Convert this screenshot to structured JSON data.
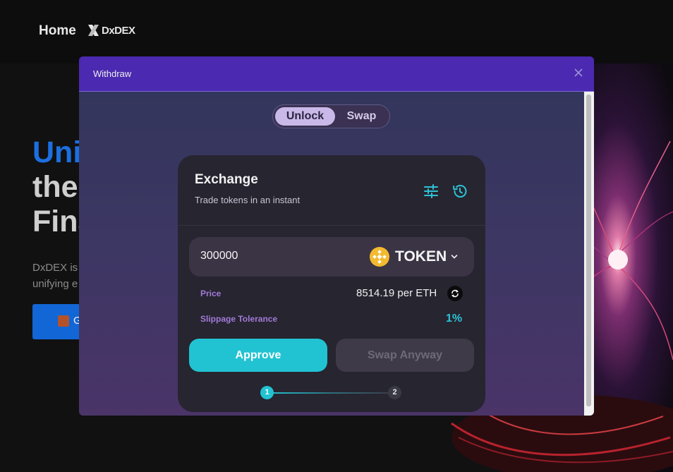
{
  "nav": {
    "home_label": "Home",
    "logo_text": "DxDEX"
  },
  "hero": {
    "title_line1": "Uni",
    "title_line2": "the",
    "title_line3": "Fina",
    "desc_line1": "DxDEX is",
    "desc_line2": "unifying e",
    "cta_label": "G"
  },
  "modal": {
    "title": "Withdraw",
    "close_icon": "close-icon",
    "tabs": [
      {
        "label": "Unlock",
        "active": true
      },
      {
        "label": "Swap",
        "active": false
      }
    ]
  },
  "exchange": {
    "title": "Exchange",
    "subtitle": "Trade tokens in an instant",
    "amount_value": "300000",
    "token_label": "TOKEN",
    "price_label": "Price",
    "price_value": "8514.19 per ETH",
    "slippage_label": "Slippage Tolerance",
    "slippage_value": "1%",
    "approve_label": "Approve",
    "swap_anyway_label": "Swap Anyway",
    "steps": [
      "1",
      "2"
    ]
  },
  "colors": {
    "accent": "#21c3d2",
    "modal_header": "#4b29b0",
    "label_purple": "#a27ad8",
    "token_gold": "#f3ba2f"
  }
}
